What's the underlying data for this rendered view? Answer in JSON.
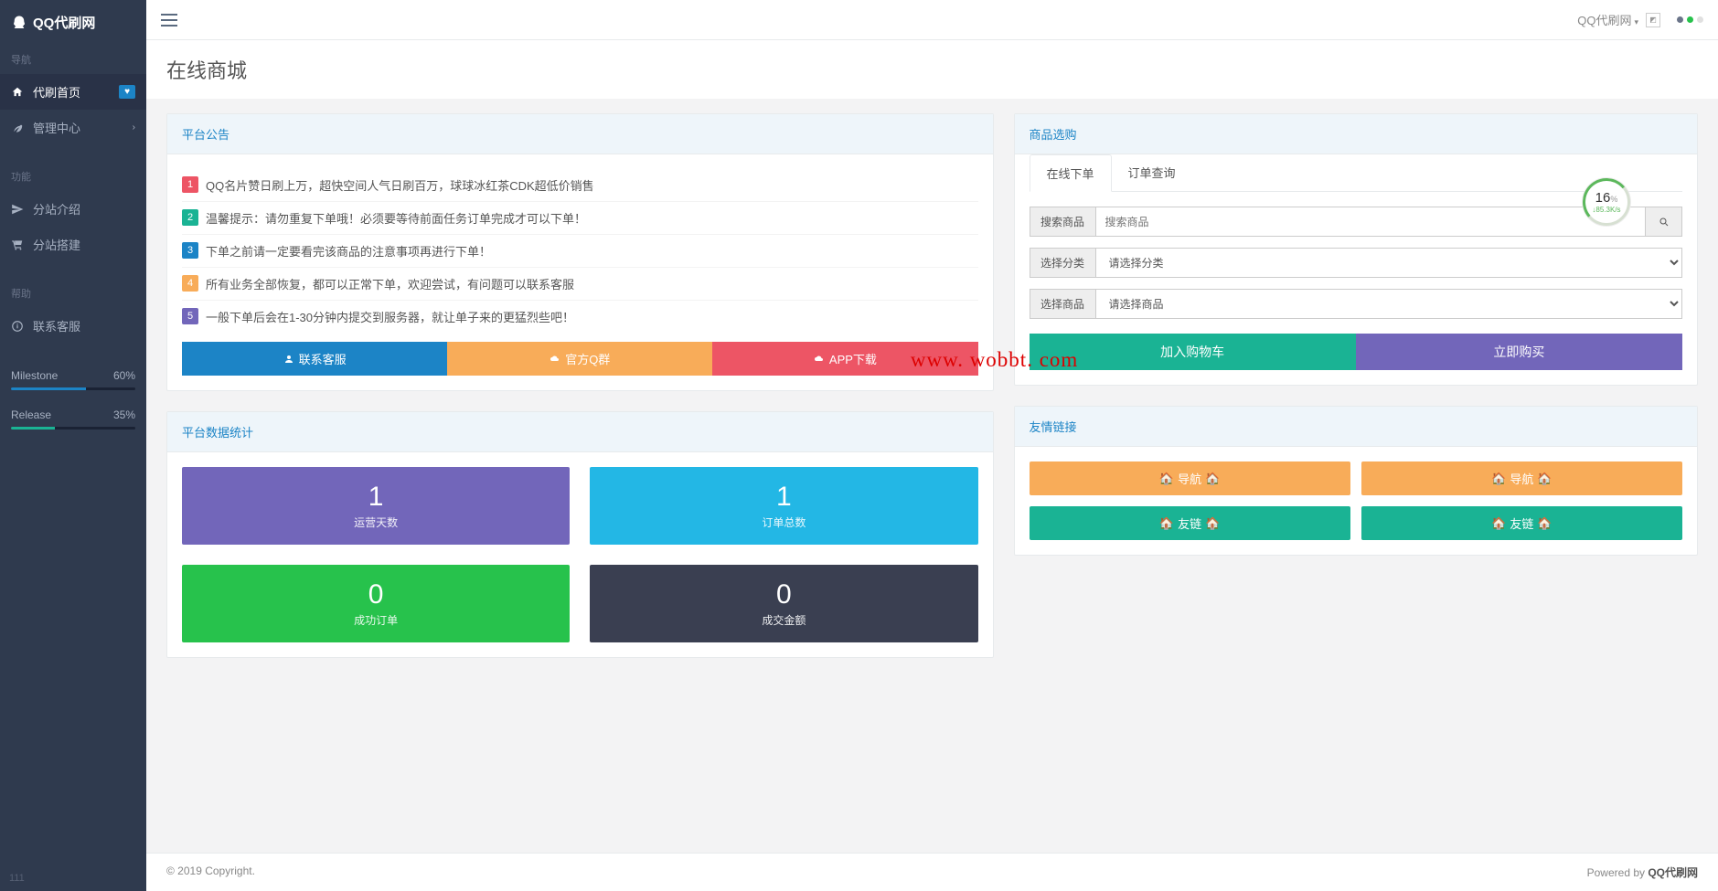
{
  "brand": "QQ代刷网",
  "nav": {
    "cat1": "导航",
    "items": [
      {
        "icon": "home",
        "label": "代刷首页",
        "ext": "heart"
      },
      {
        "icon": "leaf",
        "label": "管理中心",
        "ext": "caret"
      }
    ],
    "cat2": "功能",
    "items2": [
      {
        "icon": "plane",
        "label": "分站介绍"
      },
      {
        "icon": "cart",
        "label": "分站搭建"
      }
    ],
    "cat3": "帮助",
    "items3": [
      {
        "icon": "info",
        "label": "联系客服"
      }
    ],
    "progress": [
      {
        "name": "Milestone",
        "pct": "60%",
        "color": "#1c84c6",
        "w": 60
      },
      {
        "name": "Release",
        "pct": "35%",
        "color": "#1ab394",
        "w": 35
      }
    ],
    "foot": "111"
  },
  "topbar": {
    "brand_bk": "QQ代刷网"
  },
  "page": {
    "title": "在线商城"
  },
  "announce": {
    "title": "平台公告",
    "list": [
      {
        "n": "1",
        "c": "#ed5565",
        "t": "QQ名片赞日刷上万，超快空间人气日刷百万，球球冰红茶CDK超低价销售"
      },
      {
        "n": "2",
        "c": "#1ab394",
        "t": "温馨提示：请勿重复下单哦！必须要等待前面任务订单完成才可以下单！"
      },
      {
        "n": "3",
        "c": "#1c84c6",
        "t": "下单之前请一定要看完该商品的注意事项再进行下单！"
      },
      {
        "n": "4",
        "c": "#f8ac59",
        "t": "所有业务全部恢复，都可以正常下单，欢迎尝试，有问题可以联系客服"
      },
      {
        "n": "5",
        "c": "#7266ba",
        "t": "一般下单后会在1-30分钟内提交到服务器，就让单子来的更猛烈些吧！"
      }
    ],
    "btns": {
      "a": "联系客服",
      "b": "官方Q群",
      "c": "APP下载"
    }
  },
  "stats": {
    "title": "平台数据统计",
    "list": [
      {
        "v": "1",
        "l": "运营天数",
        "cls": "c-purple"
      },
      {
        "v": "1",
        "l": "订单总数",
        "cls": "c-blue"
      },
      {
        "v": "0",
        "l": "成功订单",
        "cls": "c-green"
      },
      {
        "v": "0",
        "l": "成交金额",
        "cls": "c-dark"
      }
    ]
  },
  "shop": {
    "title": "商品选购",
    "tabs": {
      "a": "在线下单",
      "b": "订单查询"
    },
    "f": {
      "search_lbl": "搜索商品",
      "search_ph": "搜索商品",
      "cat_lbl": "选择分类",
      "cat_sel": "请选择分类",
      "prod_lbl": "选择商品",
      "prod_sel": "请选择商品"
    },
    "btns": {
      "add": "加入购物车",
      "buy": "立即购买"
    }
  },
  "links": {
    "title": "友情链接",
    "list": [
      {
        "t": "导航",
        "cls": "lk-yellow"
      },
      {
        "t": "导航",
        "cls": "lk-yellow"
      },
      {
        "t": "友链",
        "cls": "lk-green"
      },
      {
        "t": "友链",
        "cls": "lk-green"
      }
    ]
  },
  "footer": {
    "l1": "© 2019 ",
    "l2": "Copyright.",
    "r1": "Powered by ",
    "r2": "QQ代刷网"
  },
  "gauge": {
    "pct": "16",
    "unit": "%",
    "spd": "↓85.3K/s"
  },
  "watermark": "www. wobbt. com"
}
